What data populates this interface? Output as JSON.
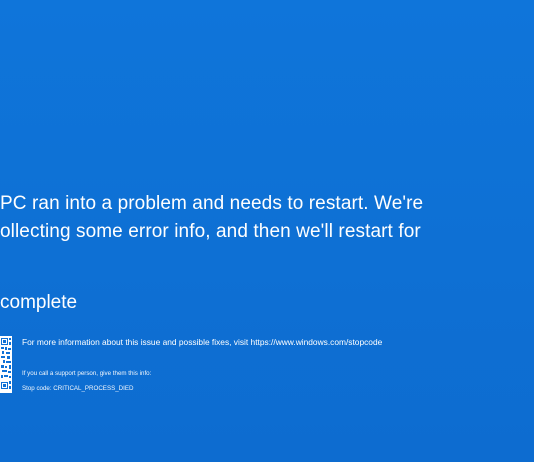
{
  "message": {
    "line1": "PC ran into a problem and needs to restart. We're",
    "line2": "ollecting some error info, and then we'll restart for"
  },
  "progress": {
    "text": "complete"
  },
  "info": {
    "more_info": "For more information about this issue and possible fixes, visit https://www.windows.com/stopcode",
    "support": "If you call a support person, give them this info:",
    "stop_code": "Stop code: CRITICAL_PROCESS_DIED"
  },
  "colors": {
    "background": "#0f71d6",
    "text": "#ffffff"
  },
  "icons": {
    "qr": "qr-code-icon"
  }
}
